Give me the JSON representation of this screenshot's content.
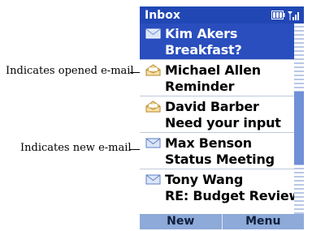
{
  "title": "Inbox",
  "softkeys": {
    "left": "New",
    "right": "Menu"
  },
  "annotations": {
    "opened": "Indicates opened e-mail",
    "new": "Indicates new e-mail"
  },
  "messages": [
    {
      "sender": "Kim Akers",
      "subject": "Breakfast?",
      "icon": "new-mail-icon",
      "selected": true
    },
    {
      "sender": "Michael Allen",
      "subject": "Reminder",
      "icon": "opened-mail-icon",
      "selected": false
    },
    {
      "sender": "David Barber",
      "subject": "Need your input",
      "icon": "opened-mail-icon",
      "selected": false
    },
    {
      "sender": "Max Benson",
      "subject": "Status Meeting",
      "icon": "new-mail-icon",
      "selected": false
    },
    {
      "sender": "Tony Wang",
      "subject": "RE: Budget Review",
      "icon": "new-mail-icon",
      "selected": false
    }
  ],
  "colors": {
    "title_bar": "#2147b5",
    "selection": "#2a4ebd",
    "softkey_bar": "#8eaad9",
    "scrollbar_thumb": "#6f8fd8"
  }
}
